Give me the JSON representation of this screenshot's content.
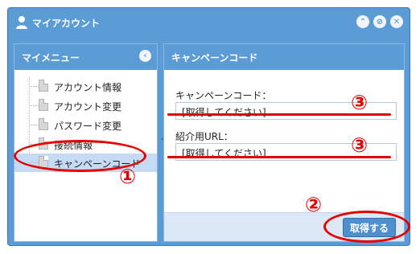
{
  "window": {
    "title": "マイアカウント",
    "icon": "user-icon",
    "buttons": [
      {
        "name": "up-icon",
        "glyph": "⌃"
      },
      {
        "name": "block-icon",
        "glyph": "⊘"
      },
      {
        "name": "close-icon",
        "glyph": "✕"
      }
    ]
  },
  "menu": {
    "header": "マイメニュー",
    "collapse_glyph": "‹",
    "items": [
      {
        "label": "アカウント情報"
      },
      {
        "label": "アカウント変更"
      },
      {
        "label": "パスワード変更"
      },
      {
        "label": "接続情報"
      },
      {
        "label": "キャンペーンコード",
        "selected": true
      }
    ]
  },
  "content": {
    "header": "キャンペーンコード",
    "campaign_code": {
      "label": "キャンペーンコード：",
      "value": "[取得してください]"
    },
    "referral_url": {
      "label": "紹介用URL：",
      "value": "[取得してください]"
    },
    "get_button": "取得する"
  },
  "annotations": {
    "marker1": "①",
    "marker2": "②",
    "marker3a": "③",
    "marker3b": "③",
    "color": "#e50000"
  }
}
